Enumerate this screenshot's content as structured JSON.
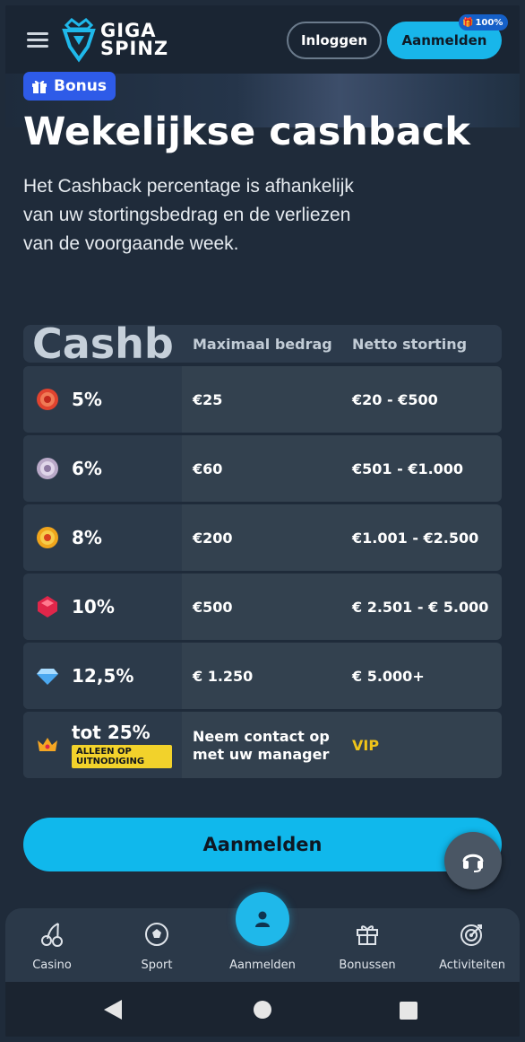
{
  "header": {
    "logo_line1": "GIGA",
    "logo_line2": "SPINZ",
    "login_label": "Inloggen",
    "signup_label": "Aanmelden",
    "signup_badge": "100%"
  },
  "hero": {
    "tag_label": "Bonus",
    "title": "Wekelijkse cashback",
    "description": "Het Cashback percentage is afhankelijk van uw stortingsbedrag en de verliezen van de voorgaande week."
  },
  "table": {
    "brand_text": "Cashback",
    "columns": [
      "Maximaal bedrag",
      "Netto storting"
    ],
    "rows": [
      {
        "icon": "ruby-coin-icon",
        "percent": "5%",
        "max": "€25",
        "net": "€20 - €500"
      },
      {
        "icon": "silver-coin-icon",
        "percent": "6%",
        "max": "€60",
        "net": "€501 - €1.000"
      },
      {
        "icon": "gold-coin-icon",
        "percent": "8%",
        "max": "€200",
        "net": "€1.001 - €2.500"
      },
      {
        "icon": "red-gem-icon",
        "percent": "10%",
        "max": "€500",
        "net": "€ 2.501 - € 5.000"
      },
      {
        "icon": "diamond-icon",
        "percent": "12,5%",
        "max": "€ 1.250",
        "net": "€ 5.000+"
      },
      {
        "icon": "crown-icon",
        "percent": "tot 25%",
        "badge": "ALLEEN OP UITNODIGING",
        "max": "Neem contact op met uw manager",
        "net": "VIP"
      }
    ]
  },
  "cta_label": "Aanmelden",
  "bottom_nav": [
    {
      "icon": "cherries-icon",
      "label": "Casino"
    },
    {
      "icon": "soccer-ball-icon",
      "label": "Sport"
    },
    {
      "icon": "user-icon",
      "label": "Aanmelden"
    },
    {
      "icon": "gift-icon",
      "label": "Bonussen"
    },
    {
      "icon": "target-icon",
      "label": "Activiteiten"
    }
  ],
  "colors": {
    "accent": "#18b6ea",
    "background": "#1f2b3a",
    "bonus_tag": "#2e5be8",
    "vip": "#f0c419"
  }
}
